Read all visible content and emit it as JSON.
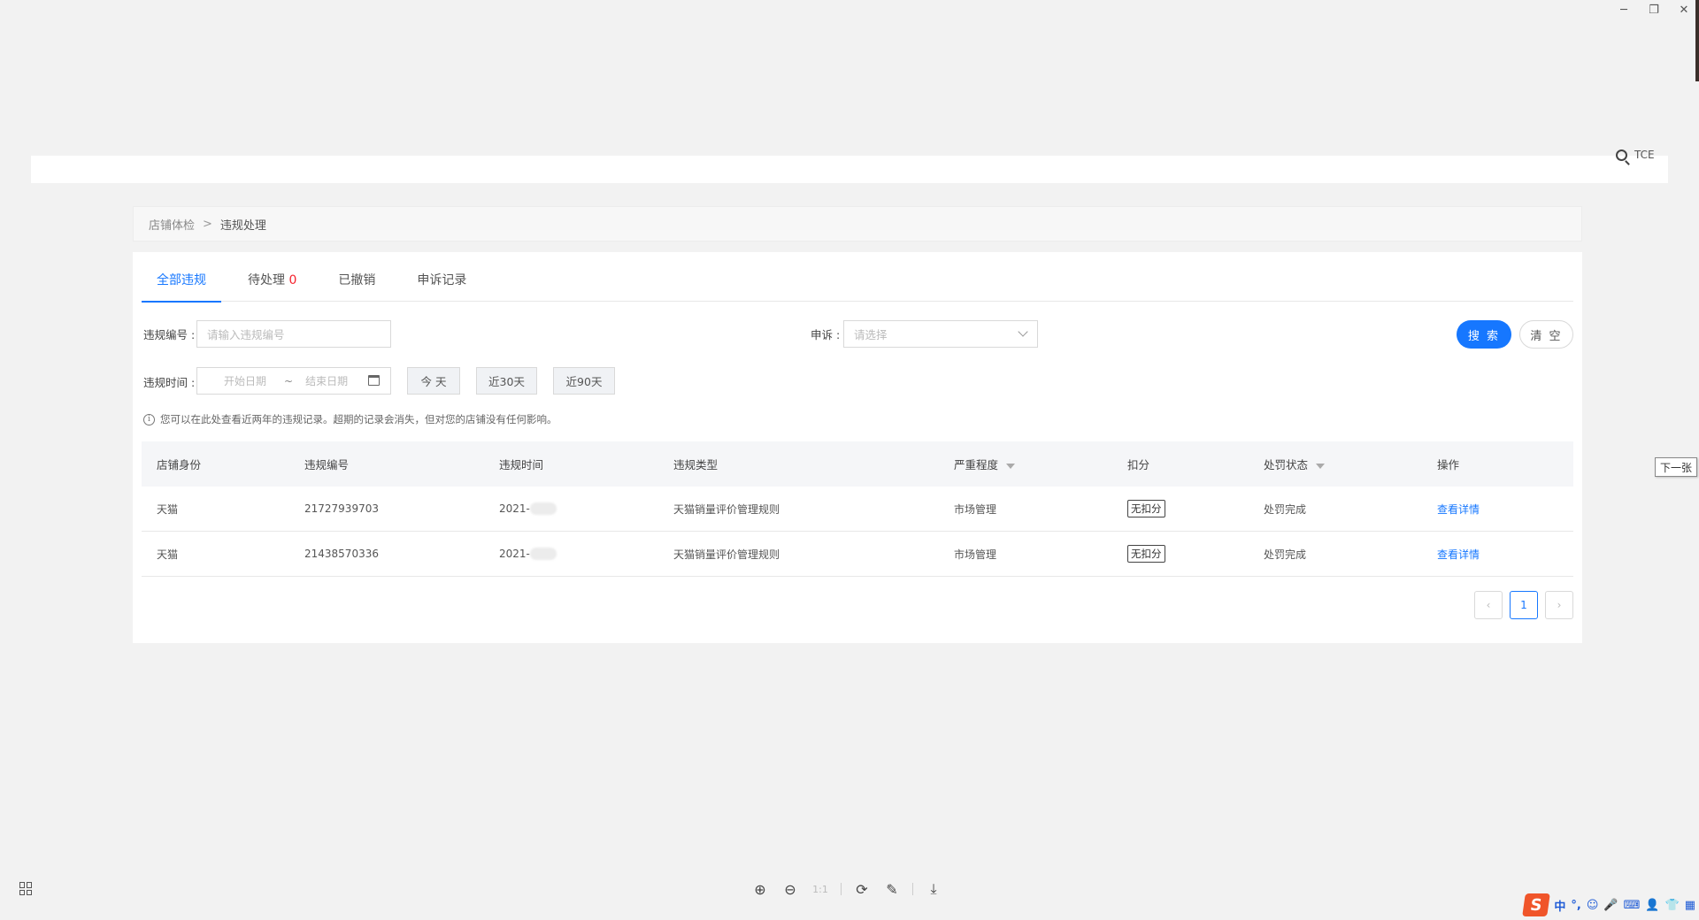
{
  "window": {
    "minimize_glyph": "─",
    "restore_glyph": "❐",
    "close_glyph": "✕"
  },
  "top_search": {
    "icon": "search-icon",
    "text": "TCE"
  },
  "breadcrumb": {
    "parent": "店铺体检",
    "separator": ">",
    "current": "违规处理"
  },
  "tabs": [
    {
      "label": "全部违规",
      "active": true
    },
    {
      "label": "待处理",
      "count": "0"
    },
    {
      "label": "已撤销"
    },
    {
      "label": "申诉记录"
    }
  ],
  "filters": {
    "violation_no_label": "违规编号 :",
    "violation_no_placeholder": "请输入违规编号",
    "appeal_label": "申诉 :",
    "appeal_placeholder": "请选择",
    "time_label": "违规时间 :",
    "start_placeholder": "开始日期",
    "range_sep": "~",
    "end_placeholder": "结束日期",
    "quick": [
      "今 天",
      "近30天",
      "近90天"
    ],
    "search_btn": "搜 索",
    "clear_btn": "清 空"
  },
  "notice": "您可以在此处查看近两年的违规记录。超期的记录会消失，但对您的店铺没有任何影响。",
  "table": {
    "headers": [
      "店铺身份",
      "违规编号",
      "违规时间",
      "违规类型",
      "严重程度",
      "扣分",
      "处罚状态",
      "操作"
    ],
    "rows": [
      [
        "天猫",
        "21727939703",
        "2021-",
        "天猫销量评价管理规则",
        "市场管理",
        "无扣分",
        "处罚完成",
        "查看详情"
      ],
      [
        "天猫",
        "21438570336",
        "2021-",
        "天猫销量评价管理规则",
        "市场管理",
        "无扣分",
        "处罚完成",
        "查看详情"
      ]
    ]
  },
  "pagination": {
    "prev": "‹",
    "current": "1",
    "next": "›"
  },
  "next_tip": "下一张",
  "accent_color": "#1677ff",
  "ime": {
    "logo": "S",
    "items": [
      "中",
      "°,",
      "☺",
      "🎤",
      "⌨",
      "👤",
      "👕",
      "▦"
    ]
  }
}
